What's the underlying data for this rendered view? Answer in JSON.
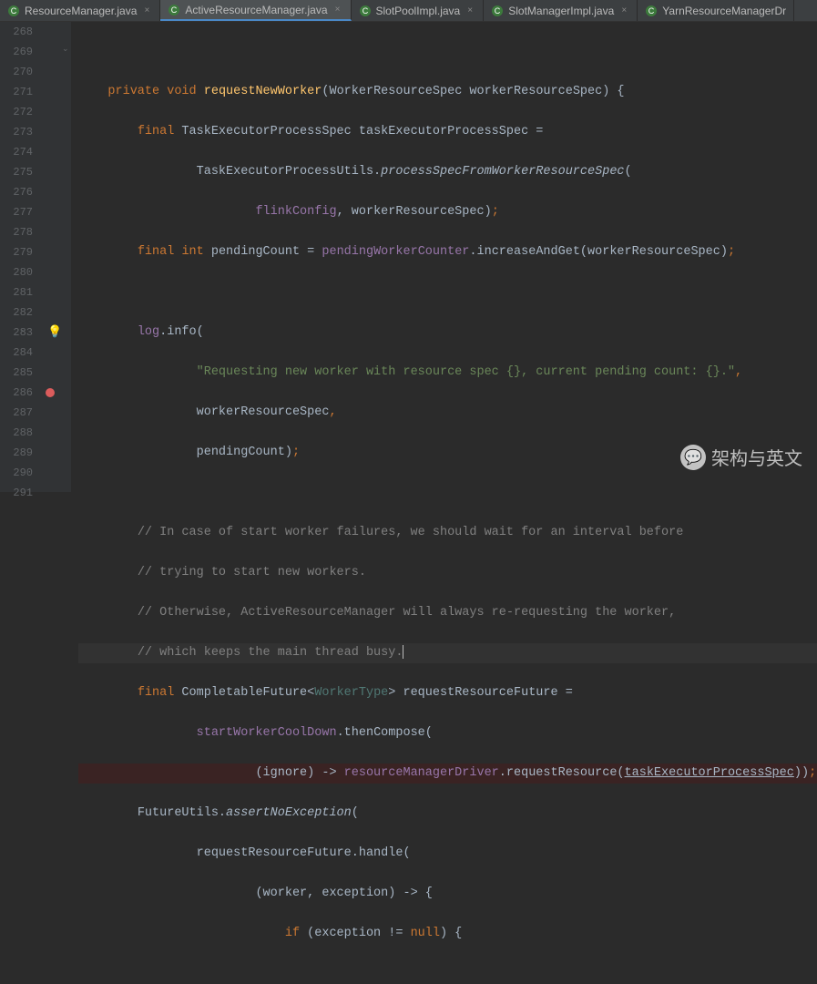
{
  "tabs": [
    {
      "label": "ResourceManager.java",
      "active": false
    },
    {
      "label": "ActiveResourceManager.java",
      "active": true
    },
    {
      "label": "SlotPoolImpl.java",
      "active": false
    },
    {
      "label": "SlotManagerImpl.java",
      "active": false
    },
    {
      "label": "YarnResourceManagerDr",
      "active": false
    }
  ],
  "lineStart": 268,
  "lineEnd": 291,
  "code": {
    "l269": {
      "kw1": "private",
      "kw2": "void",
      "method": "requestNewWorker",
      "param": "(WorkerResourceSpec workerResourceSpec) {"
    },
    "l270": {
      "kw": "final",
      "rest": " TaskExecutorProcessSpec taskExecutorProcessSpec ="
    },
    "l271": {
      "cls": "TaskExecutorProcessUtils.",
      "static": "processSpecFromWorkerResourceSpec",
      "paren": "("
    },
    "l272": {
      "member": "flinkConfig",
      "rest": ", workerResourceSpec)",
      ";": ";"
    },
    "l273": {
      "kw1": "final",
      "kw2": "int",
      "var": " pendingCount = ",
      "member": "pendingWorkerCounter",
      "call": ".increaseAndGet(workerResourceSpec)",
      ";": ";"
    },
    "l275": {
      "member": "log",
      "call": ".info("
    },
    "l276": {
      "str": "\"Requesting new worker with resource spec {}, current pending count: {}.\"",
      "comma": ","
    },
    "l277": {
      "txt": "workerResourceSpec",
      "comma": ","
    },
    "l278": {
      "txt": "pendingCount)",
      ";": ";"
    },
    "l280": {
      "c": "// In case of start worker failures, we should wait for an interval before"
    },
    "l281": {
      "c": "// trying to start new workers."
    },
    "l282": {
      "c": "// Otherwise, ActiveResourceManager will always re-requesting the worker,"
    },
    "l283": {
      "c": "// which keeps the main thread busy."
    },
    "l284": {
      "kw": "final",
      "cls": " CompletableFuture<",
      "gen": "WorkerType",
      "rest": "> requestResourceFuture ="
    },
    "l285": {
      "member": "startWorkerCoolDown",
      "call": ".thenCompose("
    },
    "l286": {
      "lam": "(ignore) -> ",
      "member": "resourceManagerDriver",
      "call": ".requestResource(",
      "under": "taskExecutorProcessSpec",
      "end": "))",
      ";": ";"
    },
    "l287": {
      "cls": "FutureUtils.",
      "static": "assertNoException",
      "paren": "("
    },
    "l288": {
      "txt": "requestResourceFuture.handle("
    },
    "l289": {
      "txt": "(worker, exception) -> {"
    },
    "l290": {
      "kw": "if",
      "txt": " (exception != ",
      "null": "null",
      "rest": ") {"
    }
  },
  "watermark": "架构与英文"
}
